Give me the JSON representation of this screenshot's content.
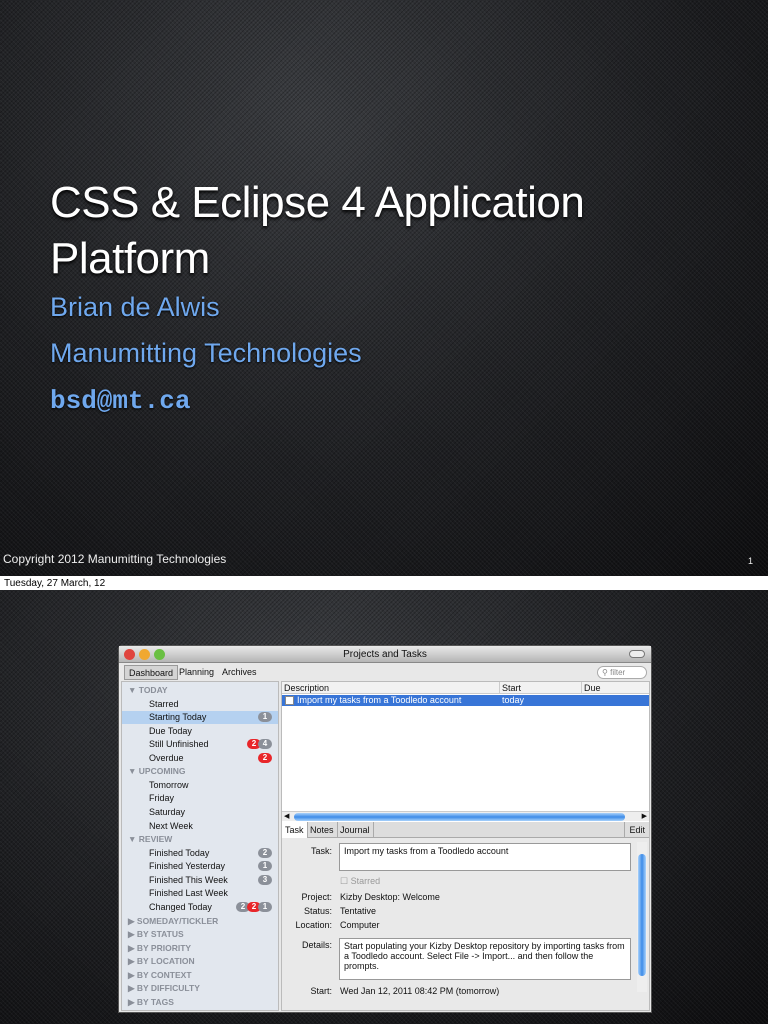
{
  "slide1": {
    "title_line1": "CSS & Eclipse 4 Application",
    "title_line2": "Platform",
    "author": "Brian de Alwis",
    "company": "Manumitting Technologies",
    "email": "bsd@mt.ca",
    "copyright": "Copyright 2012 Manumitting Technologies",
    "page_number": "1"
  },
  "date_caption": "Tuesday, 27 March, 12",
  "window": {
    "title": "Projects and Tasks",
    "toolbar": {
      "tabs": [
        "Dashboard",
        "Planning",
        "Archives"
      ],
      "filter_placeholder": "filter"
    },
    "sidebar": [
      {
        "label": "▼ TODAY",
        "type": "hdr"
      },
      {
        "label": "Starred",
        "type": "item"
      },
      {
        "label": "Starting Today",
        "type": "item",
        "selected": true,
        "badges": [
          {
            "v": "1",
            "c": "g"
          }
        ]
      },
      {
        "label": "Due Today",
        "type": "item"
      },
      {
        "label": "Still Unfinished",
        "type": "item",
        "badges": [
          {
            "v": "2",
            "c": "r"
          },
          {
            "v": "4",
            "c": "g"
          }
        ]
      },
      {
        "label": "Overdue",
        "type": "item",
        "badges": [
          {
            "v": "2",
            "c": "r"
          }
        ]
      },
      {
        "label": "▼ UPCOMING",
        "type": "hdr"
      },
      {
        "label": "Tomorrow",
        "type": "item"
      },
      {
        "label": "Friday",
        "type": "item"
      },
      {
        "label": "Saturday",
        "type": "item"
      },
      {
        "label": "Next Week",
        "type": "item"
      },
      {
        "label": "▼ REVIEW",
        "type": "hdr"
      },
      {
        "label": "Finished Today",
        "type": "item",
        "badges": [
          {
            "v": "2",
            "c": "g"
          }
        ]
      },
      {
        "label": "Finished Yesterday",
        "type": "item",
        "badges": [
          {
            "v": "1",
            "c": "g"
          }
        ]
      },
      {
        "label": "Finished This Week",
        "type": "item",
        "badges": [
          {
            "v": "3",
            "c": "g"
          }
        ]
      },
      {
        "label": "Finished Last Week",
        "type": "item"
      },
      {
        "label": "Changed Today",
        "type": "item",
        "badges": [
          {
            "v": "2",
            "c": "g"
          },
          {
            "v": "2",
            "c": "r"
          },
          {
            "v": "1",
            "c": "g"
          }
        ]
      },
      {
        "label": "▶ SOMEDAY/TICKLER",
        "type": "hdr"
      },
      {
        "label": "▶ BY STATUS",
        "type": "hdr"
      },
      {
        "label": "▶ BY PRIORITY",
        "type": "hdr"
      },
      {
        "label": "▶ BY LOCATION",
        "type": "hdr"
      },
      {
        "label": "▶ BY CONTEXT",
        "type": "hdr"
      },
      {
        "label": "▶ BY DIFFICULTY",
        "type": "hdr"
      },
      {
        "label": "▶ BY TAGS",
        "type": "hdr"
      }
    ],
    "table": {
      "columns": [
        "Description",
        "Start",
        "Due"
      ],
      "rows": [
        {
          "description": "Import my tasks from a Toodledo account",
          "start": "today",
          "due": ""
        }
      ]
    },
    "detail": {
      "tabs": [
        "Task",
        "Notes",
        "Journal"
      ],
      "edit": "Edit",
      "task_label": "Task:",
      "task": "Import my tasks from a Toodledo account",
      "starred": "Starred",
      "project_label": "Project:",
      "project": "Kizby Desktop: Welcome",
      "status_label": "Status:",
      "status": "Tentative",
      "location_label": "Location:",
      "location": "Computer",
      "details_label": "Details:",
      "details": "Start populating your Kizby Desktop repository by importing tasks from a Toodledo account.  Select File -> Import... and then follow the prompts.",
      "start_label": "Start:",
      "start": "Wed Jan 12, 2011  08:42 PM (tomorrow)"
    }
  }
}
